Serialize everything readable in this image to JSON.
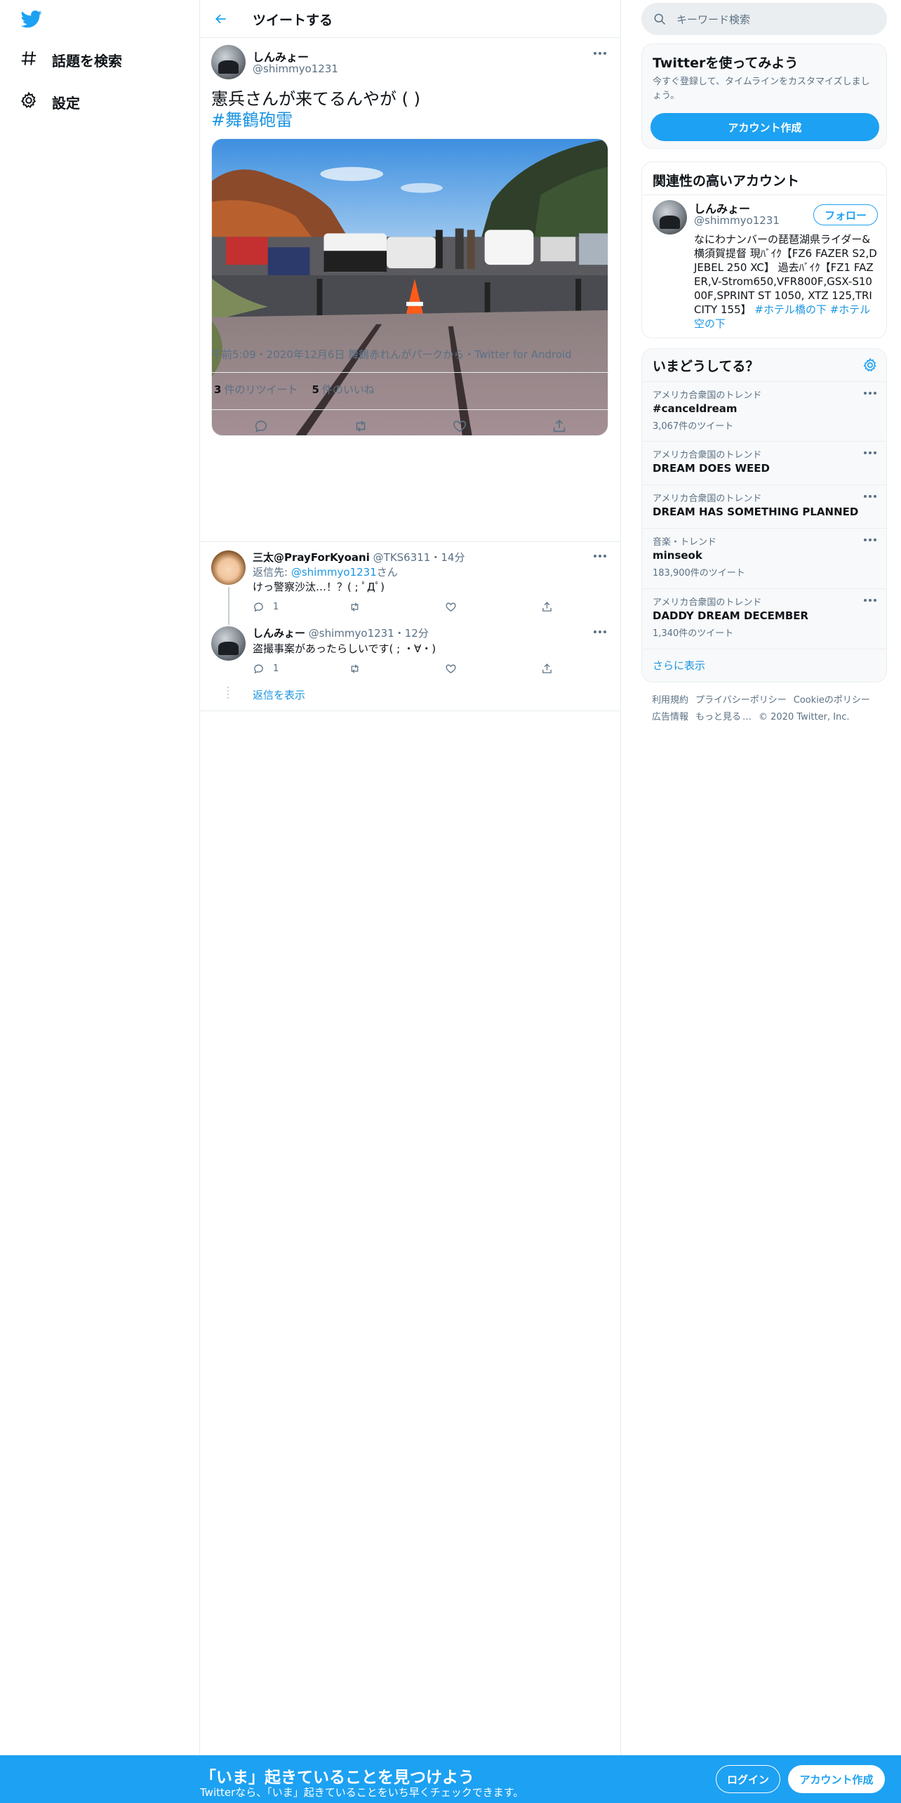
{
  "nav": {
    "items": [
      {
        "label": "話題を検索",
        "icon": "hashtag-icon"
      },
      {
        "label": "設定",
        "icon": "gear-icon"
      }
    ]
  },
  "header": {
    "title": "ツイートする"
  },
  "tweet": {
    "name": "しんみょー",
    "handle": "@shimmyo1231",
    "text": "憲兵さんが来てるんやが ( )",
    "hashtag": "#舞鶴砲雷",
    "meta": "午前5:09・2020年12月6日 舞鶴赤れんがパークから・",
    "app": "Twitter for Android",
    "retweets": {
      "count": "3",
      "label": "件のリツイート"
    },
    "likes": {
      "count": "5",
      "label": "件のいいね"
    }
  },
  "replies": [
    {
      "name": "三太@PrayForKyoani",
      "handle": "@TKS6311",
      "time": "・14分",
      "replying_prefix": "返信先: ",
      "replying_user": "@shimmyo1231",
      "replying_suffix": "さん",
      "text": "けっ警察沙汰…！？( ; ﾟДﾟ)",
      "reply_count": "1"
    },
    {
      "name": "しんみょー",
      "handle": "@shimmyo1231",
      "time": "・12分",
      "text": "盗撮事案があったらしいです( ; ・∀・)",
      "reply_count": "1"
    }
  ],
  "show_replies": "返信を表示",
  "search": {
    "placeholder": "キーワード検索"
  },
  "signup_panel": {
    "title": "Twitterを使ってみよう",
    "subtitle": "今すぐ登録して、タイムラインをカスタマイズしましょう。",
    "button": "アカウント作成"
  },
  "related": {
    "title": "関連性の高いアカウント",
    "name": "しんみょー",
    "handle": "@shimmyo1231",
    "follow": "フォロー",
    "bio": "なにわナンバーの琵琶湖県ライダー&横須賀提督 現ﾊﾞｲｸ【FZ6 FAZER S2,DJEBEL 250 XC】 過去ﾊﾞｲｸ【FZ1 FAZER,V-Strom650,VFR800F,GSX-S1000F,SPRINT ST 1050, XTZ 125,TRICITY 155】 ",
    "bio_tags": "#ホテル橋の下 #ホテル空の下"
  },
  "trends": {
    "title": "いまどうしてる？",
    "items": [
      {
        "context": "アメリカ合衆国のトレンド",
        "name": "#canceldream",
        "count": "3,067件のツイート"
      },
      {
        "context": "アメリカ合衆国のトレンド",
        "name": "DREAM DOES WEED",
        "count": ""
      },
      {
        "context": "アメリカ合衆国のトレンド",
        "name": "DREAM HAS SOMETHING PLANNED",
        "count": ""
      },
      {
        "context": "音楽・トレンド",
        "name": "minseok",
        "count": "183,900件のツイート"
      },
      {
        "context": "アメリカ合衆国のトレンド",
        "name": "DADDY DREAM DECEMBER",
        "count": "1,340件のツイート"
      }
    ],
    "show_more": "さらに表示"
  },
  "footer": {
    "links": [
      "利用規約",
      "プライバシーポリシー",
      "Cookieのポリシー",
      "広告情報",
      "もっと見る"
    ],
    "copyright": "© 2020 Twitter, Inc."
  },
  "bottombar": {
    "title": "「いま」起きていることを見つけよう",
    "subtitle": "Twitterなら、「いま」起きていることをいち早くチェックできます。",
    "login": "ログイン",
    "signup": "アカウント作成"
  },
  "colors": {
    "accent": "#1da1f2",
    "link": "#1b95e0",
    "secondary_text": "#5b7083",
    "border": "#e6ecf0"
  }
}
